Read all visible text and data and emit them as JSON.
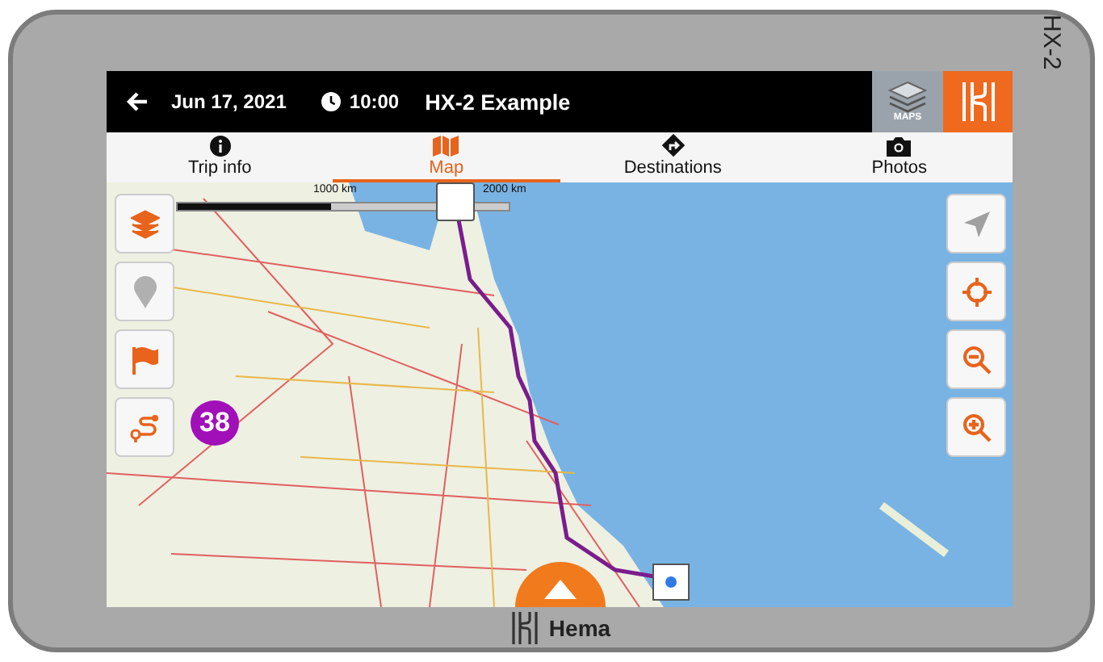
{
  "device": {
    "model_label": "HX-2",
    "brand": "Hema"
  },
  "header": {
    "date": "Jun 17, 2021",
    "time": "10:00",
    "title": "HX-2 Example",
    "maps_button": "MAPS"
  },
  "tabs": [
    {
      "label": "Trip info",
      "kind": "info",
      "selected": false
    },
    {
      "label": "Map",
      "kind": "map",
      "selected": true
    },
    {
      "label": "Destinations",
      "kind": "destinations",
      "selected": false
    },
    {
      "label": "Photos",
      "kind": "photos",
      "selected": false
    }
  ],
  "map": {
    "scale_labels": [
      "1000 km",
      "2000 km"
    ],
    "route_badge": "38"
  }
}
